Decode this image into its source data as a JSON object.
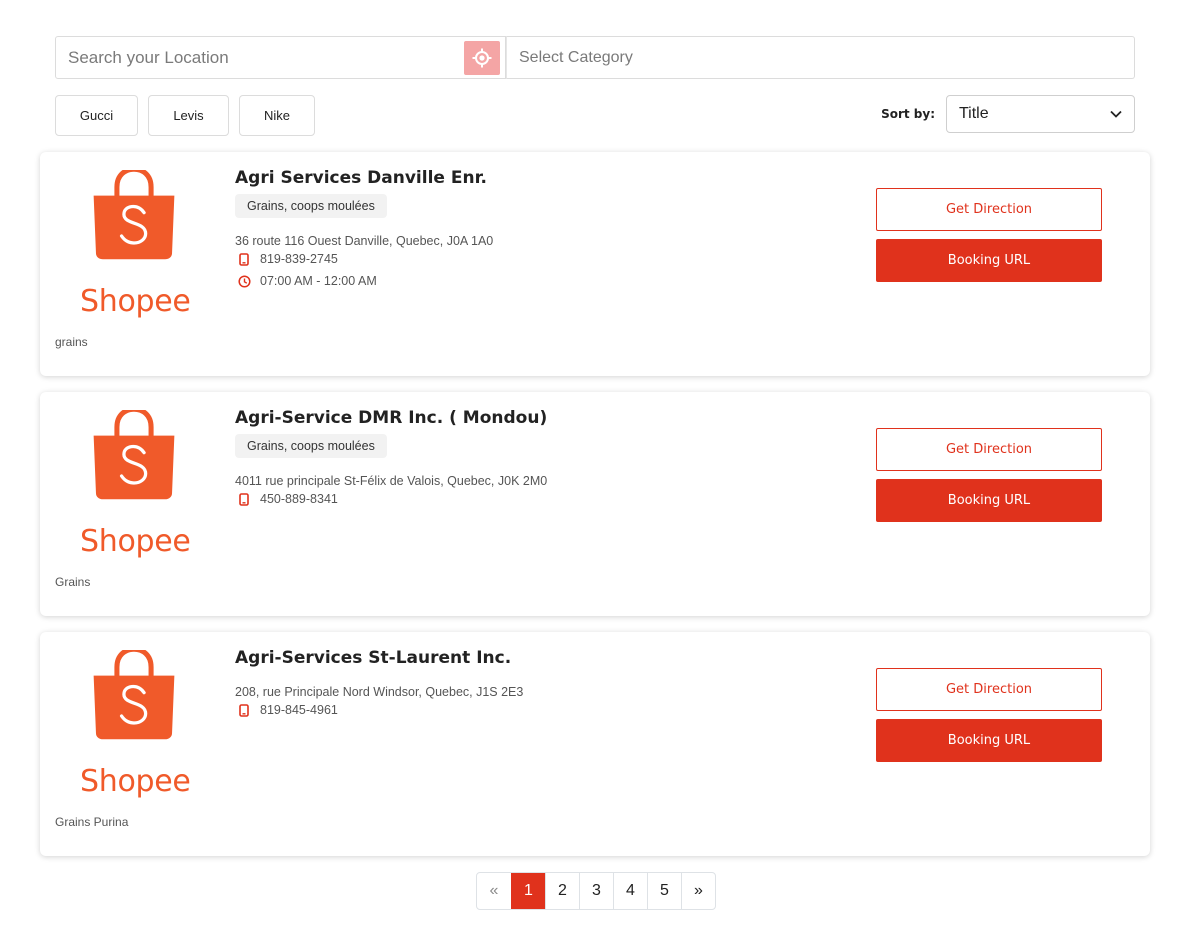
{
  "search": {
    "location_placeholder": "Search your Location",
    "category_placeholder": "Select Category",
    "locate_icon": "crosshair-icon"
  },
  "tags": [
    "Gucci",
    "Levis",
    "Nike"
  ],
  "sort": {
    "label": "Sort by:",
    "value": "Title"
  },
  "colors": {
    "accent": "#e0321c",
    "locate_button": "#f4a5a5",
    "shopee_orange": "#f05a2a"
  },
  "logo": {
    "text": "Shopee",
    "icon": "shopee-bag-logo"
  },
  "listings": [
    {
      "title": "Agri Services Danville Enr.",
      "tag": "Grains, coops moulées",
      "address": "36 route 116 Ouest Danville, Quebec, J0A 1A0",
      "phone": "819-839-2745",
      "hours": "07:00 AM - 12:00 AM",
      "category": "grains",
      "direction_label": "Get Direction",
      "booking_label": "Booking URL"
    },
    {
      "title": "Agri-Service DMR Inc. ( Mondou)",
      "tag": "Grains, coops moulées",
      "address": "4011 rue principale St-Félix de Valois, Quebec, J0K 2M0",
      "phone": "450-889-8341",
      "category": "Grains",
      "direction_label": "Get Direction",
      "booking_label": "Booking URL"
    },
    {
      "title": "Agri-Services St-Laurent Inc.",
      "address": "208, rue Principale Nord Windsor, Quebec, J1S 2E3",
      "phone": "819-845-4961",
      "category": "Grains Purina",
      "direction_label": "Get Direction",
      "booking_label": "Booking URL"
    }
  ],
  "pagination": {
    "prev": "«",
    "pages": [
      "1",
      "2",
      "3",
      "4",
      "5"
    ],
    "current": "1",
    "next": "»"
  }
}
